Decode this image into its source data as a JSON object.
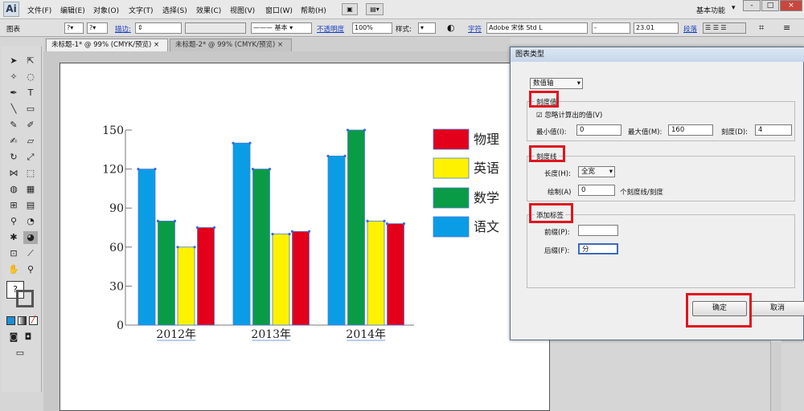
{
  "app": {
    "logo": "Ai",
    "menus": [
      "文件(F)",
      "编辑(E)",
      "对象(O)",
      "文字(T)",
      "选择(S)",
      "效果(C)",
      "视图(V)",
      "窗口(W)",
      "帮助(H)"
    ],
    "workspace": "基本功能",
    "window_buttons": [
      "-",
      "□",
      "×"
    ]
  },
  "options": {
    "object_label": "图表",
    "stroke_link": "描边:",
    "basic": "基本",
    "opacity_link": "不透明度",
    "opacity_value": "100%",
    "style_label": "样式:",
    "char_link": "字符",
    "font": "Adobe 宋体 Std L",
    "font_style": "-",
    "font_size": "23.01",
    "para_link": "段落"
  },
  "tabs": [
    "未标题-1* @ 99% (CMYK/预览)",
    "未标题-2* @ 99% (CMYK/预览)"
  ],
  "chart_data": {
    "type": "bar",
    "categories": [
      "2012年",
      "2013年",
      "2014年"
    ],
    "series": [
      {
        "name": "语文",
        "color": "#0a9de5",
        "values": [
          120,
          140,
          130
        ]
      },
      {
        "name": "数学",
        "color": "#0a9b46",
        "values": [
          80,
          120,
          150
        ]
      },
      {
        "name": "英语",
        "color": "#fff200",
        "values": [
          60,
          70,
          80
        ]
      },
      {
        "name": "物理",
        "color": "#e2001a",
        "values": [
          75,
          72,
          78
        ]
      }
    ],
    "yticks": [
      "0",
      "30",
      "60",
      "90",
      "120",
      "150"
    ],
    "ylim": [
      0,
      150
    ],
    "legend_order": [
      "物理",
      "英语",
      "数学",
      "语文"
    ]
  },
  "dialog": {
    "title": "图表类型",
    "axis_select": "数值轴",
    "tick_values": {
      "title": "刻度值",
      "override_label": "忽略计算出的值(V)",
      "min_label": "最小值(I):",
      "min_value": "0",
      "max_label": "最大值(M):",
      "max_value": "160",
      "div_label": "刻度(D):",
      "div_value": "4"
    },
    "tick_marks": {
      "title": "刻度线",
      "length_label": "长度(H):",
      "length_value": "全宽",
      "draw_label": "绘制(A)",
      "draw_value": "0",
      "draw_suffix": "个刻度线/刻度"
    },
    "labels": {
      "title": "添加标签",
      "prefix_label": "前缀(P):",
      "prefix_value": "",
      "suffix_label": "后缀(F):",
      "suffix_value": "分"
    },
    "ok": "确定",
    "cancel": "取消"
  }
}
